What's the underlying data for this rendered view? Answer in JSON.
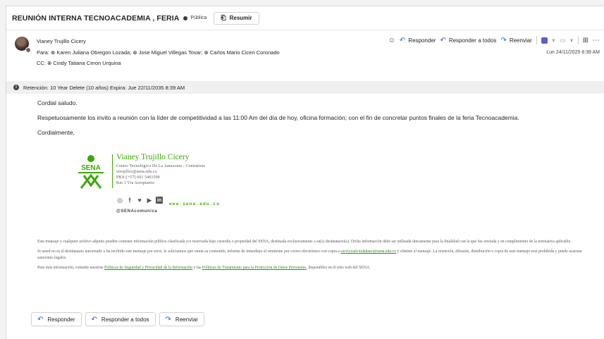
{
  "subject": {
    "title": "REUNIÓN INTERNA TECNOACADEMIA , FERIA",
    "visibility": "Pública",
    "summarize_label": "Resumir"
  },
  "header": {
    "sender": "Vianey Trujillo Cicery",
    "to_label": "Para:",
    "recipients": [
      "Karen Juliana Obregon Lozada;",
      "Jose Miguel Villegas Tovar;",
      "Carlos Mario Ciceri Coronado"
    ],
    "cc_label": "CC:",
    "cc": [
      "Cindy Tatiana Ceron Urquina"
    ],
    "date": "Lun 24/11/2025 8:39 AM"
  },
  "actions": {
    "reply": "Responder",
    "reply_all": "Responder a todos",
    "forward": "Reenviar"
  },
  "retention": "Retención: 10 Year Delete (10 años) Expira: Jue 22/11/2035 8:39 AM",
  "body": {
    "greeting": "Cordial saludo.",
    "paragraph": "Respetuosamente los invito a reunión con la líder de competitividad a las 11:00 Am del día de hoy, oficina formación; con el  fin de concretar puntos finales de la feria Tecnoacademia.",
    "closing": "Cordialmente,"
  },
  "signature": {
    "logo_text": "SENA",
    "name": "Vianey Trujillo Cicery",
    "lines": [
      "Centro Tecnológico De La Amazonia - Contratista",
      "vtrujilloc@sena.edu.co",
      "PBX:(+57) 601 5461500",
      "Km 3 Vía Aeropuerto"
    ],
    "website": "www.sena.edu.co",
    "handle": "@SENAcomunica"
  },
  "disclaimer": {
    "p1": "Este mensaje y cualquier archivo adjunto pueden contener información pública clasificada y/o reservada bajo custodia o propiedad del SENA, destinada exclusivamente a su(s) destinatario(s). Dicha información debe ser utilizada únicamente para la finalidad con la que fue enviada y en cumplimiento de la normativa aplicable.",
    "p2_a": "Si usted no es el destinatario autorizado o ha recibido este mensaje por error, le solicitamos que omita su contenido, informe de inmediato al remitente por correo electrónico con copia a ",
    "p2_link": "servicioalciudadano@sena.edu.co",
    "p2_b": " y elimine el mensaje. La retención, difusión, distribución o copia de este mensaje está prohibida y puede acarrear sanciones legales.",
    "p3_a": "Para más información, consulte nuestras ",
    "p3_link1": "Políticas de Seguridad y Privacidad de la Información",
    "p3_mid": " y las ",
    "p3_link2": "Políticas de Tratamiento para la Protección de Datos Personales",
    "p3_b": ", disponibles en el sitio web del SENA."
  },
  "footer": {
    "reply": "Responder",
    "reply_all": "Responder a todos",
    "forward": "Reenviar"
  },
  "colors": {
    "accent": "#0f6cbd",
    "sena_green": "#39a900"
  }
}
